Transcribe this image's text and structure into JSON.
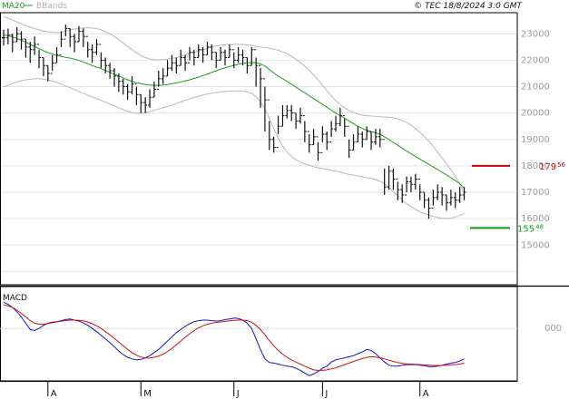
{
  "header": {
    "legend": [
      {
        "label": "MA20",
        "color": "#1f9a1f"
      },
      {
        "label": "BBands",
        "color": "#b0b0b0"
      }
    ],
    "copyright": "© TEC 18/8/2024 3:0 GMT"
  },
  "macd_label": "MACD",
  "chart_data": [
    {
      "type": "ohlc",
      "yticks": [
        15000,
        16000,
        17000,
        18000,
        19000,
        20000,
        21000,
        22000,
        23000
      ],
      "ytick_labels": [
        "15000",
        "16000",
        "17000",
        "18000",
        "19000",
        "20000",
        "21000",
        "22000",
        "23000"
      ],
      "ylim": [
        13500,
        23800
      ],
      "x_month_labels": [
        {
          "label": "A",
          "index": 10
        },
        {
          "label": "M",
          "index": 31
        },
        {
          "label": "J",
          "index": 52
        },
        {
          "label": "J",
          "index": 72
        },
        {
          "label": "A",
          "index": 94
        }
      ],
      "closes": [
        22850,
        22950,
        22700,
        23000,
        22800,
        22500,
        22400,
        22600,
        22100,
        21800,
        21500,
        21900,
        22200,
        22800,
        23200,
        22900,
        22700,
        23100,
        22900,
        22400,
        22300,
        22600,
        22000,
        21800,
        21600,
        21400,
        21200,
        21000,
        20800,
        21100,
        20700,
        20400,
        20300,
        20600,
        20900,
        21300,
        21400,
        21700,
        21900,
        21800,
        22100,
        21900,
        22300,
        22100,
        22400,
        22200,
        22500,
        22300,
        22000,
        22300,
        22100,
        22400,
        22000,
        22200,
        22100,
        21800,
        22400,
        21800,
        21300,
        20500,
        19000,
        18700,
        19500,
        19900,
        20100,
        20000,
        19700,
        19900,
        19300,
        18800,
        19100,
        18500,
        19200,
        18900,
        19400,
        19600,
        19900,
        19500,
        18600,
        18900,
        19200,
        19000,
        19300,
        18900,
        19100,
        19000,
        17200,
        17800,
        17500,
        17100,
        16900,
        17400,
        17300,
        17500,
        17000,
        16700,
        16400,
        16800,
        17000,
        16900,
        16600,
        16800,
        16700,
        16900,
        17000
      ],
      "highs": [
        23150,
        23200,
        23000,
        23250,
        23100,
        22800,
        22700,
        22900,
        22400,
        22100,
        21800,
        22200,
        22500,
        23100,
        23350,
        23200,
        23000,
        23300,
        23200,
        22700,
        22600,
        22800,
        22300,
        22100,
        21900,
        21700,
        21500,
        21300,
        21100,
        21400,
        21000,
        20700,
        20600,
        20900,
        21200,
        21600,
        21700,
        22000,
        22200,
        22100,
        22400,
        22200,
        22500,
        22400,
        22600,
        22500,
        22700,
        22600,
        22300,
        22500,
        22400,
        22600,
        22300,
        22500,
        22400,
        22100,
        22500,
        22100,
        21700,
        21000,
        19700,
        19100,
        19900,
        20300,
        20300,
        20300,
        20000,
        20200,
        19700,
        19200,
        19400,
        18900,
        19500,
        19300,
        19700,
        19900,
        20200,
        19800,
        19000,
        19200,
        19500,
        19300,
        19500,
        19300,
        19400,
        19400,
        17900,
        18000,
        17900,
        17400,
        17300,
        17600,
        17600,
        17700,
        17300,
        17000,
        16800,
        17100,
        17300,
        17200,
        16900,
        17100,
        17000,
        17200,
        17200
      ],
      "lows": [
        22550,
        22600,
        22300,
        22700,
        22400,
        22100,
        21900,
        22200,
        21700,
        21400,
        21200,
        21600,
        21900,
        22500,
        22900,
        22500,
        22300,
        22700,
        22500,
        22100,
        21900,
        22200,
        21700,
        21500,
        21300,
        21000,
        20800,
        20700,
        20500,
        20700,
        20300,
        20000,
        20000,
        20200,
        20600,
        21000,
        21100,
        21400,
        21600,
        21500,
        21800,
        21600,
        22000,
        21800,
        22100,
        21900,
        22200,
        22000,
        21700,
        22000,
        21800,
        22100,
        21700,
        21900,
        21800,
        21500,
        21800,
        21000,
        20200,
        19300,
        18600,
        18500,
        19200,
        19500,
        19800,
        19700,
        19400,
        19600,
        18900,
        18500,
        18800,
        18200,
        18900,
        18600,
        19100,
        19300,
        19500,
        19100,
        18300,
        18600,
        18900,
        18700,
        19000,
        18600,
        18800,
        18700,
        16900,
        17100,
        17100,
        16700,
        16600,
        17000,
        17000,
        17100,
        16700,
        16400,
        16000,
        16500,
        16700,
        16500,
        16300,
        16500,
        16400,
        16600,
        16700
      ],
      "ma20": [
        22950,
        22930,
        22880,
        22820,
        22760,
        22680,
        22600,
        22520,
        22440,
        22360,
        22290,
        22230,
        22180,
        22140,
        22110,
        22080,
        22040,
        21990,
        21930,
        21870,
        21800,
        21740,
        21680,
        21610,
        21540,
        21470,
        21400,
        21330,
        21260,
        21200,
        21150,
        21110,
        21080,
        21060,
        21050,
        21050,
        21060,
        21080,
        21110,
        21140,
        21180,
        21220,
        21260,
        21310,
        21360,
        21420,
        21480,
        21540,
        21600,
        21660,
        21710,
        21760,
        21810,
        21850,
        21880,
        21900,
        21910,
        21900,
        21860,
        21780,
        21650,
        21520,
        21400,
        21300,
        21200,
        21090,
        20980,
        20870,
        20770,
        20660,
        20550,
        20440,
        20330,
        20220,
        20110,
        20000,
        19900,
        19800,
        19700,
        19600,
        19500,
        19420,
        19350,
        19300,
        19250,
        19200,
        19100,
        19000,
        18890,
        18780,
        18670,
        18560,
        18460,
        18360,
        18260,
        18160,
        18060,
        17960,
        17860,
        17760,
        17660,
        17550,
        17440,
        17330,
        17150
      ],
      "bb_upper": [
        23650,
        23600,
        23520,
        23450,
        23380,
        23300,
        23250,
        23200,
        23150,
        23100,
        23080,
        23060,
        23050,
        23060,
        23100,
        23150,
        23180,
        23200,
        23220,
        23230,
        23220,
        23200,
        23150,
        23080,
        23000,
        22900,
        22780,
        22650,
        22520,
        22400,
        22280,
        22180,
        22100,
        22050,
        22020,
        22010,
        22020,
        22040,
        22070,
        22100,
        22150,
        22200,
        22250,
        22300,
        22350,
        22400,
        22450,
        22500,
        22540,
        22570,
        22590,
        22600,
        22610,
        22610,
        22600,
        22580,
        22560,
        22520,
        22500,
        22480,
        22450,
        22420,
        22380,
        22320,
        22250,
        22150,
        22040,
        21920,
        21780,
        21620,
        21440,
        21250,
        21050,
        20850,
        20650,
        20470,
        20320,
        20200,
        20100,
        20020,
        19960,
        19920,
        19900,
        19890,
        19880,
        19860,
        19850,
        19840,
        19820,
        19780,
        19720,
        19640,
        19540,
        19420,
        19280,
        19120,
        18940,
        18740,
        18520,
        18300,
        18080,
        17850,
        17600,
        17300,
        16950
      ],
      "bb_lower": [
        21000,
        21050,
        21120,
        21180,
        21220,
        21260,
        21280,
        21300,
        21300,
        21280,
        21250,
        21210,
        21160,
        21100,
        21030,
        20960,
        20890,
        20820,
        20750,
        20680,
        20610,
        20550,
        20480,
        20410,
        20340,
        20270,
        20200,
        20130,
        20070,
        20020,
        19990,
        19990,
        20010,
        20050,
        20100,
        20150,
        20200,
        20250,
        20300,
        20360,
        20420,
        20480,
        20540,
        20590,
        20640,
        20680,
        20720,
        20750,
        20780,
        20800,
        20820,
        20830,
        20840,
        20840,
        20830,
        20800,
        20740,
        20620,
        20430,
        20150,
        19800,
        19400,
        19050,
        18750,
        18520,
        18350,
        18230,
        18150,
        18080,
        18020,
        17970,
        17930,
        17900,
        17870,
        17840,
        17800,
        17760,
        17720,
        17680,
        17650,
        17620,
        17590,
        17560,
        17520,
        17480,
        17420,
        17320,
        17180,
        17020,
        16860,
        16710,
        16570,
        16450,
        16350,
        16270,
        16200,
        16140,
        16090,
        16050,
        16020,
        16010,
        16020,
        16060,
        16130,
        16200
      ],
      "levels": [
        {
          "label": "179.56",
          "main": "179",
          "sup": "56",
          "value": 18000,
          "color": "#cc0000"
        },
        {
          "label": "155.48",
          "main": "155",
          "sup": "48",
          "value": 15650,
          "color": "#119911"
        }
      ]
    },
    {
      "type": "line",
      "title": "MACD",
      "yticks": [
        0
      ],
      "ytick_labels": [
        "000"
      ],
      "ylim": [
        -1000,
        800
      ],
      "series": [
        {
          "name": "MACD",
          "color": "#1414c8",
          "values": [
            500,
            460,
            400,
            320,
            220,
            100,
            -20,
            -40,
            0,
            60,
            100,
            120,
            130,
            150,
            170,
            180,
            160,
            140,
            110,
            60,
            0,
            -60,
            -130,
            -200,
            -270,
            -350,
            -430,
            -500,
            -550,
            -580,
            -600,
            -590,
            -560,
            -520,
            -460,
            -400,
            -320,
            -240,
            -160,
            -80,
            -20,
            40,
            90,
            130,
            150,
            160,
            160,
            150,
            140,
            150,
            170,
            180,
            200,
            190,
            160,
            100,
            0,
            -200,
            -400,
            -580,
            -650,
            -660,
            -680,
            -700,
            -720,
            -730,
            -760,
            -800,
            -850,
            -900,
            -870,
            -820,
            -760,
            -720,
            -640,
            -600,
            -580,
            -560,
            -540,
            -520,
            -480,
            -450,
            -400,
            -420,
            -480,
            -560,
            -640,
            -700,
            -720,
            -720,
            -700,
            -690,
            -690,
            -690,
            -700,
            -710,
            -730,
            -730,
            -720,
            -700,
            -680,
            -660,
            -650,
            -620,
            -580
          ]
        },
        {
          "name": "Signal",
          "color": "#cc1111",
          "values": [
            450,
            430,
            400,
            350,
            290,
            220,
            150,
            100,
            80,
            80,
            95,
            110,
            125,
            140,
            150,
            160,
            160,
            155,
            145,
            125,
            90,
            50,
            0,
            -60,
            -120,
            -190,
            -260,
            -330,
            -400,
            -460,
            -510,
            -545,
            -560,
            -565,
            -550,
            -525,
            -490,
            -440,
            -380,
            -310,
            -240,
            -170,
            -100,
            -40,
            10,
            50,
            80,
            100,
            115,
            125,
            135,
            145,
            155,
            160,
            160,
            150,
            120,
            60,
            -20,
            -120,
            -230,
            -330,
            -420,
            -490,
            -550,
            -600,
            -640,
            -680,
            -720,
            -760,
            -790,
            -800,
            -800,
            -790,
            -770,
            -750,
            -720,
            -690,
            -660,
            -630,
            -600,
            -575,
            -550,
            -540,
            -545,
            -560,
            -580,
            -605,
            -630,
            -650,
            -665,
            -675,
            -680,
            -685,
            -690,
            -695,
            -700,
            -705,
            -705,
            -705,
            -700,
            -695,
            -690,
            -680,
            -660
          ]
        }
      ]
    }
  ]
}
